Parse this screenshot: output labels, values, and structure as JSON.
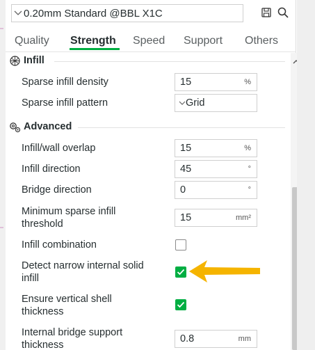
{
  "preset": {
    "name": "0.20mm Standard @BBL X1C",
    "save_icon": "save-icon",
    "search_icon": "search-icon"
  },
  "tabs": [
    {
      "label": "Quality",
      "active": false
    },
    {
      "label": "Strength",
      "active": true
    },
    {
      "label": "Speed",
      "active": false
    },
    {
      "label": "Support",
      "active": false
    },
    {
      "label": "Others",
      "active": false
    }
  ],
  "sections": {
    "infill": {
      "title": "Infill",
      "icon": "infill-grid-icon",
      "settings": {
        "density": {
          "label": "Sparse infill density",
          "value": "15",
          "unit": "%"
        },
        "pattern": {
          "label": "Sparse infill pattern",
          "value": "Grid"
        }
      }
    },
    "advanced": {
      "title": "Advanced",
      "icon": "gears-icon",
      "settings": {
        "wall_overlap": {
          "label": "Infill/wall overlap",
          "value": "15",
          "unit": "%"
        },
        "infill_direction": {
          "label": "Infill direction",
          "value": "45",
          "unit": "°"
        },
        "bridge_direction": {
          "label": "Bridge direction",
          "value": "0",
          "unit": "°"
        },
        "min_sparse_threshold": {
          "label_line1": "Minimum sparse infill",
          "label_line2": "threshold",
          "value": "15",
          "unit": "mm²"
        },
        "infill_combination": {
          "label": "Infill combination",
          "checked": false
        },
        "detect_narrow": {
          "label_line1": "Detect narrow internal solid",
          "label_line2": "infill",
          "checked": true
        },
        "ensure_vertical": {
          "label_line1": "Ensure vertical shell",
          "label_line2": "thickness",
          "checked": true
        },
        "bridge_support": {
          "label_line1": "Internal bridge support",
          "label_line2": "thickness",
          "value": "0.8",
          "unit": "mm"
        }
      }
    }
  },
  "colors": {
    "accent": "#00ae42",
    "annotation_arrow": "#f5b400"
  }
}
